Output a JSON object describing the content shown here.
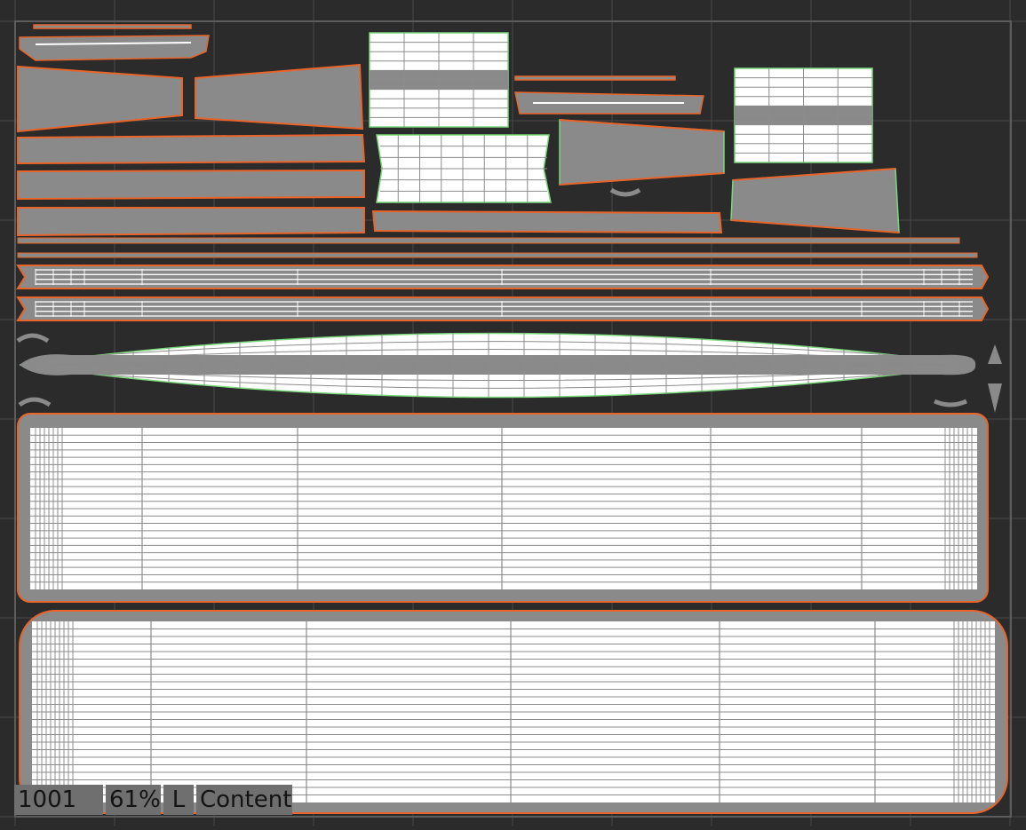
{
  "udim_tile": "1001",
  "zoom": "61%",
  "layer": "L",
  "mode": "Content",
  "colors": {
    "background": "#2b2b2b",
    "grid": "#4a4a4a",
    "shell_fill": "#8a8a8a",
    "wire_fill": "#ffffff",
    "wire_line": "#8c8c8c",
    "seam_edge": "#e8642a",
    "selected_edge": "#7bd87b",
    "status_bg": "#6f6f6f"
  },
  "icons": {
    "tile_frame": "udim-tile-frame-icon"
  }
}
